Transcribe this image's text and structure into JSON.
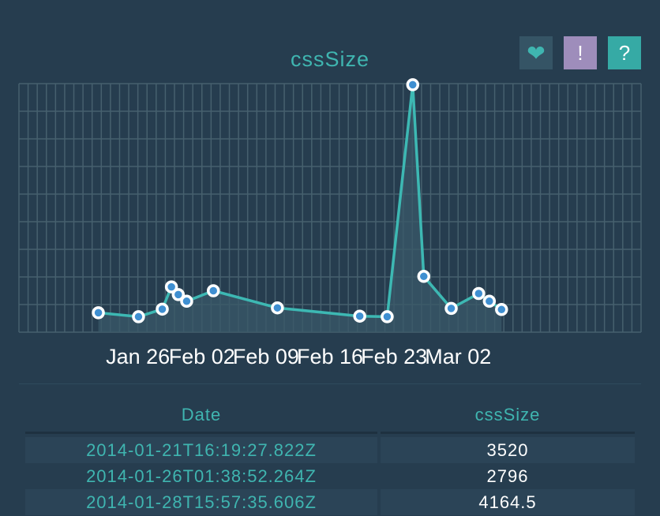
{
  "title": "cssSize",
  "buttons": {
    "heart": "❤",
    "alert": "!",
    "help": "?"
  },
  "table": {
    "headers": [
      "Date",
      "cssSize"
    ],
    "rows": [
      {
        "date": "2014-01-21T16:19:27.822Z",
        "value": "3520"
      },
      {
        "date": "2014-01-26T01:38:52.264Z",
        "value": "2796"
      },
      {
        "date": "2014-01-28T15:57:35.606Z",
        "value": "4164.5"
      }
    ]
  },
  "chart_data": {
    "type": "area",
    "title": "cssSize",
    "xlabel": "",
    "ylabel": "",
    "x_tick_labels": [
      "Jan 26",
      "Feb 02",
      "Feb 09",
      "Feb 16",
      "Feb 23",
      "Mar 02"
    ],
    "x_ticks": [
      "2014-01-26",
      "2014-02-02",
      "2014-02-09",
      "2014-02-16",
      "2014-02-23",
      "2014-03-02"
    ],
    "xlim": [
      "2014-01-13",
      "2014-03-22"
    ],
    "ylim": [
      0,
      45000
    ],
    "y_grid_step": 5000,
    "x_grid": "daily",
    "grid": true,
    "legend": "none",
    "series": [
      {
        "x": [
          "2014-01-21T16:19:27.822Z",
          "2014-01-26T01:38:52.264Z",
          "2014-01-28T15:57:35.606Z",
          "2014-01-29T16:00:00Z",
          "2014-01-30T10:00:00Z",
          "2014-01-31T08:00:00Z",
          "2014-02-03T06:00:00Z",
          "2014-02-10T06:00:00Z",
          "2014-02-19T06:00:00Z",
          "2014-02-22T06:00:00Z",
          "2014-02-25T01:00:00Z",
          "2014-02-26T06:00:00Z",
          "2014-03-01T06:00:00Z",
          "2014-03-04T06:00:00Z",
          "2014-03-05T10:00:00Z",
          "2014-03-06T18:00:00Z"
        ],
        "y": [
          3520,
          2796,
          4164.5,
          8200,
          6800,
          5600,
          7500,
          4400,
          2900,
          2800,
          44800,
          10100,
          4300,
          7000,
          5600,
          4100
        ]
      }
    ],
    "colors": {
      "line": "#3db8b3",
      "area": "#3a5868",
      "grid": "#46606e",
      "marker_fill": "#3f8fd1",
      "marker_stroke": "#ffffff"
    }
  }
}
